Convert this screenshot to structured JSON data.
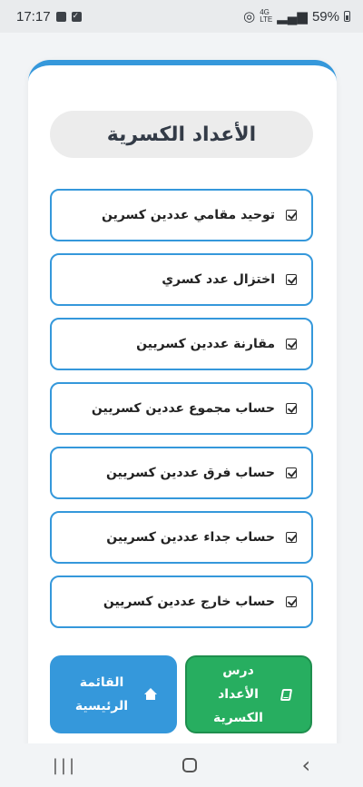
{
  "status_bar": {
    "time": "17:17",
    "network_top": "4G",
    "network_bottom": "LTE",
    "battery": "59%"
  },
  "page": {
    "title": "الأعداد الكسرية"
  },
  "topics": [
    {
      "label": "توحيد مقامي عددين كسرين"
    },
    {
      "label": "اختزال عدد كسري"
    },
    {
      "label": "مقارنة عددين كسريين"
    },
    {
      "label": "حساب مجموع عددين كسريين"
    },
    {
      "label": "حساب فرق عددين كسريين"
    },
    {
      "label": "حساب جداء عددين كسريين"
    },
    {
      "label": "حساب خارج عددين كسريين"
    }
  ],
  "buttons": {
    "lesson_label": "درس الأعداد الكسرية",
    "home_label": "القائمة الرئيسية"
  },
  "colors": {
    "accent": "#3598db",
    "lesson_button": "#27ae60",
    "home_button": "#3598db"
  },
  "icons": {
    "topic": "check-square-icon",
    "lesson": "book-icon",
    "home": "home-icon"
  }
}
